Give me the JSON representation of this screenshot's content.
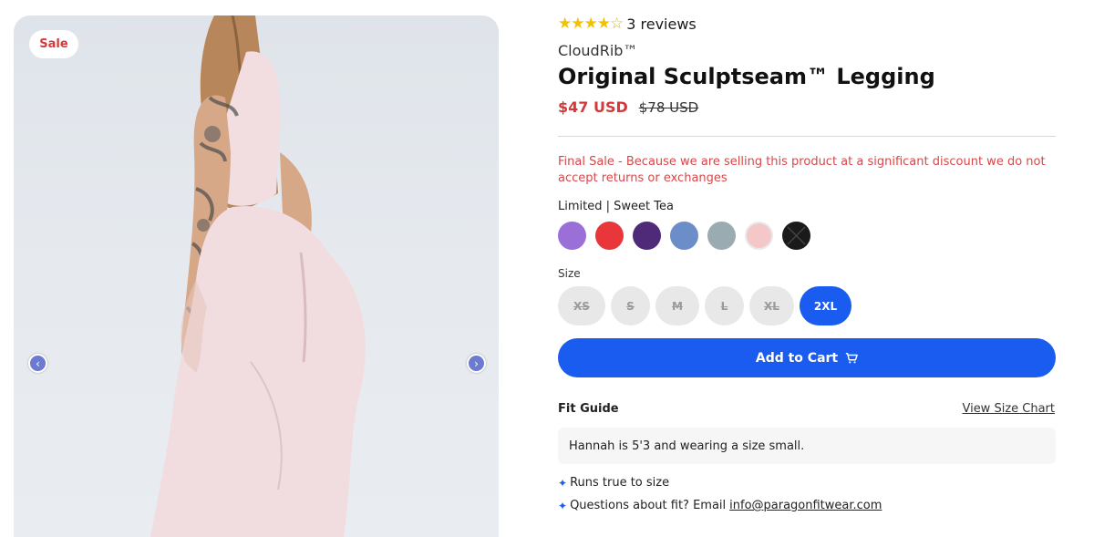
{
  "badge": {
    "sale": "Sale"
  },
  "gallery": {
    "prev_icon": "‹",
    "next_icon": "›"
  },
  "product": {
    "rating_value": 4,
    "rating_max": 5,
    "reviews": "3 reviews",
    "brand": "CloudRib™",
    "title": "Original Sculptseam™ Legging",
    "price_sale": "$47 USD",
    "price_original": "$78 USD",
    "final_sale_notice": "Final Sale - Because we are selling this product at a significant discount we do not accept returns or exchanges"
  },
  "color": {
    "label": "Limited | Sweet Tea",
    "swatches": [
      "#9a6fd8",
      "#e8363b",
      "#4f2a78",
      "#6b8ec8",
      "#9aabb2",
      "#f4c8c8",
      "#1a1a1a"
    ]
  },
  "size": {
    "label": "Size",
    "options": [
      {
        "label": "XS",
        "available": false
      },
      {
        "label": "S",
        "available": false
      },
      {
        "label": "M",
        "available": false
      },
      {
        "label": "L",
        "available": false
      },
      {
        "label": "XL",
        "available": false
      },
      {
        "label": "2XL",
        "available": true,
        "selected": true
      }
    ]
  },
  "cart": {
    "label": "Add to Cart",
    "icon": "cart-icon"
  },
  "fit": {
    "title": "Fit Guide",
    "size_chart_link": "View Size Chart",
    "note": "Hannah is 5'3 and wearing a size small.",
    "bullet1": "Runs true to size",
    "bullet2_prefix": "Questions about fit? Email",
    "email": "info@paragonfitwear.com"
  },
  "colors": {
    "accent": "#1b5cf0",
    "sale_red": "#d6383a",
    "star": "#f2c200"
  }
}
